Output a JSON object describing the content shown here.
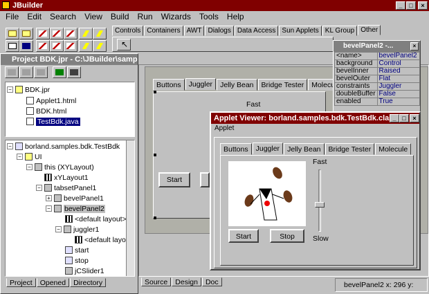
{
  "app": {
    "title": "JBuilder"
  },
  "menu": [
    "File",
    "Edit",
    "Search",
    "View",
    "Build",
    "Run",
    "Wizards",
    "Tools",
    "Help"
  ],
  "palette_tabs": [
    "Controls",
    "Containers",
    "AWT",
    "Dialogs",
    "Data Access",
    "Sun Applets",
    "KL Group",
    "Other"
  ],
  "project": {
    "title": "Project BDK.jpr - C:\\JBuilder\\samples\\borland\\samples\\bdk\\TestBdk.java",
    "files": [
      "BDK.jpr",
      "Applet1.html",
      "BDK.html",
      "TestBdk.java"
    ],
    "tabs": [
      "Project",
      "Opened",
      "Directory"
    ]
  },
  "structure": {
    "root": "borland.samples.bdk.TestBdk",
    "nodes": [
      "UI",
      "this (XYLayout)",
      "xYLayout1",
      "tabsetPanel1",
      "bevelPanel1",
      "bevelPanel2",
      "<default layout>",
      "juggler1",
      "<default layou",
      "start",
      "stop",
      "jCSlider1"
    ]
  },
  "designer": {
    "tabs": [
      "Buttons",
      "Juggler",
      "Jelly Bean",
      "Bridge Tester",
      "Molecule"
    ],
    "fast_label": "Fast",
    "start_label": "Start",
    "bottom_tabs": [
      "Source",
      "Design",
      "Doc"
    ],
    "status": "bevelPanel2 x: 296 y:"
  },
  "inspector": {
    "title": "bevelPanel2 -...",
    "rows": [
      {
        "name": "<name>",
        "value": "bevelPanel2"
      },
      {
        "name": "background",
        "value": "Control"
      },
      {
        "name": "bevelInner",
        "value": "Raised"
      },
      {
        "name": "bevelOuter",
        "value": "Flat"
      },
      {
        "name": "constraints",
        "value": "Juggler"
      },
      {
        "name": "doubleBuffer",
        "value": "False"
      },
      {
        "name": "enabled",
        "value": "True"
      }
    ]
  },
  "applet": {
    "title": "Applet Viewer: borland.samples.bdk.TestBdk.class",
    "menu": "Applet",
    "tabs": [
      "Buttons",
      "Juggler",
      "Jelly Bean",
      "Bridge Tester",
      "Molecule"
    ],
    "fast_label": "Fast",
    "slow_label": "Slow",
    "start_label": "Start",
    "stop_label": "Stop"
  }
}
